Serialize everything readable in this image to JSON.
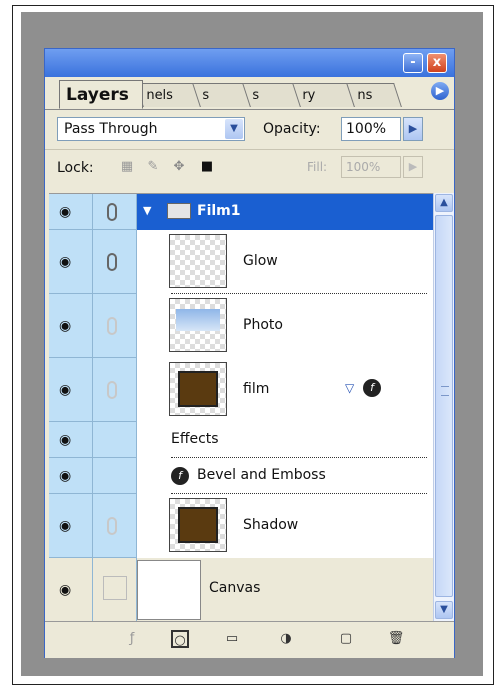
{
  "panel": {
    "title_buttons": {
      "minimize": "-",
      "close": "x"
    },
    "tabs": [
      {
        "label": "Layers",
        "active": true
      },
      {
        "label": "nels"
      },
      {
        "label": "s"
      },
      {
        "label": "s"
      },
      {
        "label": "ry"
      },
      {
        "label": "ns"
      }
    ],
    "tab_menu_icon": "menu-arrow-icon"
  },
  "blend": {
    "mode": "Pass Through"
  },
  "opacity": {
    "label": "Opacity:",
    "value": "100%"
  },
  "lock": {
    "label": "Lock:"
  },
  "fill": {
    "label": "Fill:",
    "value": "100%"
  },
  "layers": [
    {
      "name": "Film1",
      "type": "group",
      "selected": true
    },
    {
      "name": "Glow",
      "type": "layer"
    },
    {
      "name": "Photo",
      "type": "layer"
    },
    {
      "name": "film",
      "type": "layer",
      "has_effects": true
    },
    {
      "name": "Effects",
      "type": "effects-header"
    },
    {
      "name": "Bevel and Emboss",
      "type": "effect"
    },
    {
      "name": "Shadow",
      "type": "layer"
    },
    {
      "name": "Canvas",
      "type": "layer"
    }
  ],
  "colors": {
    "selected_row": "#1a5fd1",
    "eye_column": "#bfe0f7",
    "panel_bg": "#ece9d8"
  },
  "bottom_icons": [
    "layer-style-icon",
    "add-mask-icon",
    "new-group-icon",
    "adjustment-layer-icon",
    "new-layer-icon",
    "trash-icon"
  ]
}
